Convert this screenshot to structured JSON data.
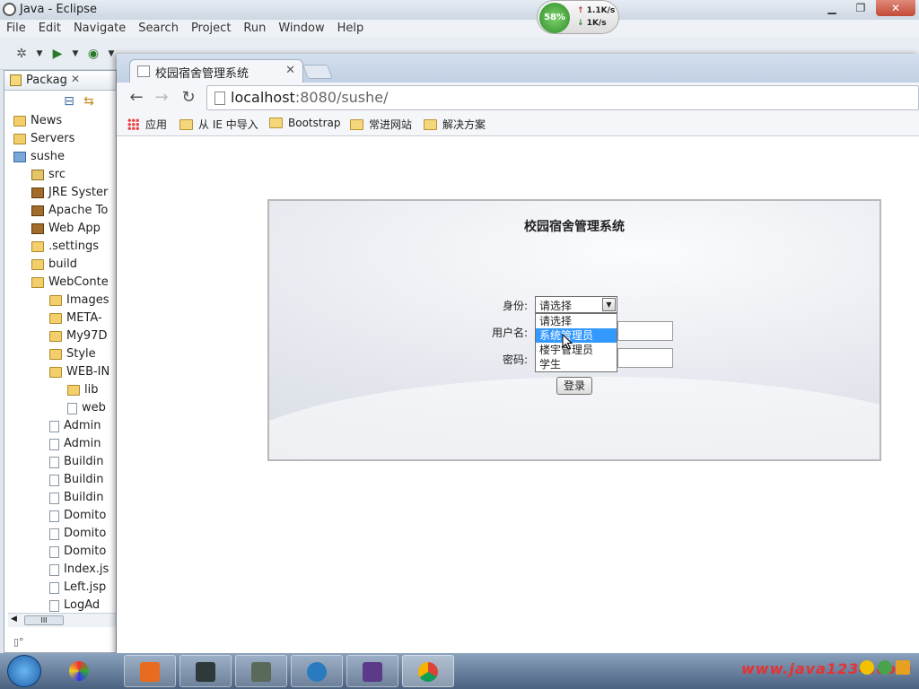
{
  "eclipse": {
    "title": "Java - Eclipse",
    "menu": [
      "File",
      "Edit",
      "Navigate",
      "Search",
      "Project",
      "Run",
      "Window",
      "Help"
    ],
    "net_widget": {
      "percent": "58%",
      "up": "1.1K/s",
      "down": "1K/s"
    },
    "package_explorer": {
      "tab_label": "Packag",
      "tab_close": "✕",
      "tree": [
        {
          "label": "News",
          "icon": "folder",
          "indent": 1
        },
        {
          "label": "Servers",
          "icon": "folder",
          "indent": 1
        },
        {
          "label": "sushe",
          "icon": "proj",
          "indent": 1
        },
        {
          "label": "src",
          "icon": "src",
          "indent": 2
        },
        {
          "label": "JRE Syster",
          "icon": "jar",
          "indent": 2
        },
        {
          "label": "Apache To",
          "icon": "jar",
          "indent": 2
        },
        {
          "label": "Web App",
          "icon": "jar",
          "indent": 2
        },
        {
          "label": ".settings",
          "icon": "folder",
          "indent": 2
        },
        {
          "label": "build",
          "icon": "folder",
          "indent": 2
        },
        {
          "label": "WebConte",
          "icon": "folder",
          "indent": 2
        },
        {
          "label": "Images",
          "icon": "folder",
          "indent": 3
        },
        {
          "label": "META-",
          "icon": "folder",
          "indent": 3
        },
        {
          "label": "My97D",
          "icon": "folder",
          "indent": 3
        },
        {
          "label": "Style",
          "icon": "folder",
          "indent": 3
        },
        {
          "label": "WEB-IN",
          "icon": "folder",
          "indent": 3
        },
        {
          "label": "lib",
          "icon": "folder",
          "indent": 4
        },
        {
          "label": "web",
          "icon": "file",
          "indent": 4
        },
        {
          "label": "Admin",
          "icon": "file",
          "indent": 3
        },
        {
          "label": "Admin",
          "icon": "file",
          "indent": 3
        },
        {
          "label": "Buildin",
          "icon": "file",
          "indent": 3
        },
        {
          "label": "Buildin",
          "icon": "file",
          "indent": 3
        },
        {
          "label": "Buildin",
          "icon": "file",
          "indent": 3
        },
        {
          "label": "Domito",
          "icon": "file",
          "indent": 3
        },
        {
          "label": "Domito",
          "icon": "file",
          "indent": 3
        },
        {
          "label": "Domito",
          "icon": "file",
          "indent": 3
        },
        {
          "label": "Index.js",
          "icon": "file",
          "indent": 3
        },
        {
          "label": "Left.jsp",
          "icon": "file",
          "indent": 3
        },
        {
          "label": "LogAd",
          "icon": "file",
          "indent": 3
        }
      ],
      "scroll_thumb": "III"
    }
  },
  "chrome": {
    "tab_title": "校园宿舍管理系统",
    "tab_close": "✕",
    "url_host": "localhost",
    "url_rest": ":8080/sushe/",
    "bookmarks": [
      {
        "label": "应用",
        "icon": "apps"
      },
      {
        "label": "从 IE 中导入",
        "icon": "folder"
      },
      {
        "label": "Bootstrap",
        "icon": "folder"
      },
      {
        "label": "常进网站",
        "icon": "folder"
      },
      {
        "label": "解决方案",
        "icon": "folder"
      }
    ]
  },
  "login": {
    "title": "校园宿舍管理系统",
    "role_label": "身份:",
    "username_label": "用户名:",
    "password_label": "密码:",
    "role_selected": "请选择",
    "role_options": [
      "请选择",
      "系统管理员",
      "楼宇管理员",
      "学生"
    ],
    "highlighted_option_index": 1,
    "submit_label": "登录"
  },
  "taskbar": {
    "watermark": "www.java1234.com"
  }
}
